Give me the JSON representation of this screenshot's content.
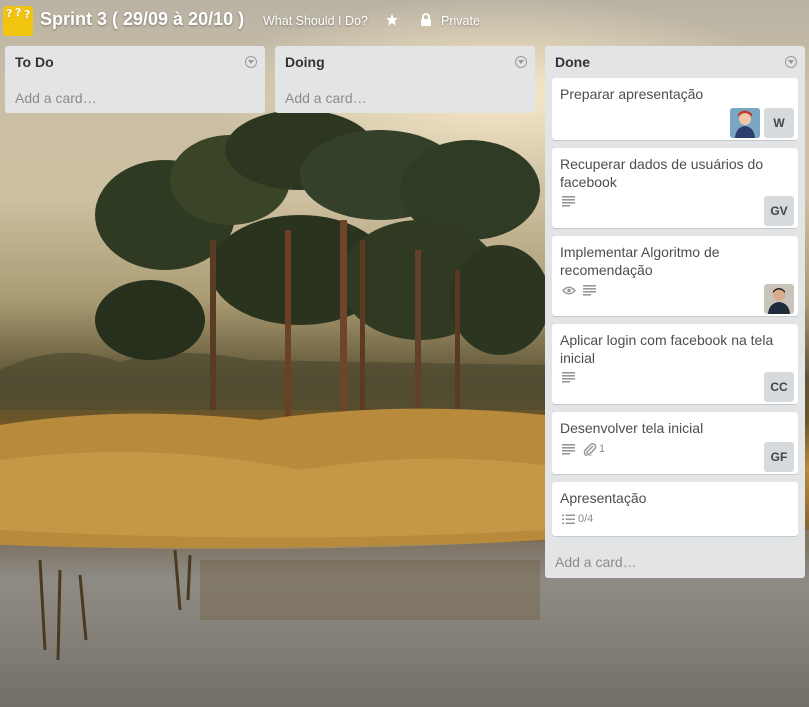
{
  "header": {
    "title": "Sprint 3 ( 29/09 à 20/10 )",
    "org_link": "What Should I Do?",
    "visibility": "Private",
    "logo_glyph": "?"
  },
  "lists": [
    {
      "title": "To Do",
      "add_label": "Add a card…",
      "cards": []
    },
    {
      "title": "Doing",
      "add_label": "Add a card…",
      "cards": []
    },
    {
      "title": "Done",
      "add_label": "Add a card…",
      "cards": [
        {
          "title": "Preparar apresentação",
          "members": [
            "photo-girl",
            "W"
          ]
        },
        {
          "title": "Recuperar dados de usuários do facebook",
          "badges": [
            "description-icon"
          ],
          "members": [
            "GV"
          ]
        },
        {
          "title": "Implementar Algoritmo de recomendação",
          "badges": [
            "eye-icon",
            "description-icon"
          ],
          "members": [
            "photo-man"
          ]
        },
        {
          "title": "Aplicar login com facebook na tela inicial",
          "badges": [
            "description-icon"
          ],
          "members": [
            "CC"
          ]
        },
        {
          "title": "Desenvolver tela inicial",
          "badges": [
            "description-icon",
            "attachment-icon"
          ],
          "attachments": "1",
          "members": [
            "GF"
          ]
        },
        {
          "title": "Apresentação",
          "badges": [
            "checklist-icon"
          ],
          "checklist": "0/4"
        }
      ]
    }
  ],
  "colors": {
    "list_bg": "#e2e4e6",
    "card_bg": "#ffffff",
    "member_bg": "#d6dadc",
    "logo_bg": "#f1c40f"
  }
}
